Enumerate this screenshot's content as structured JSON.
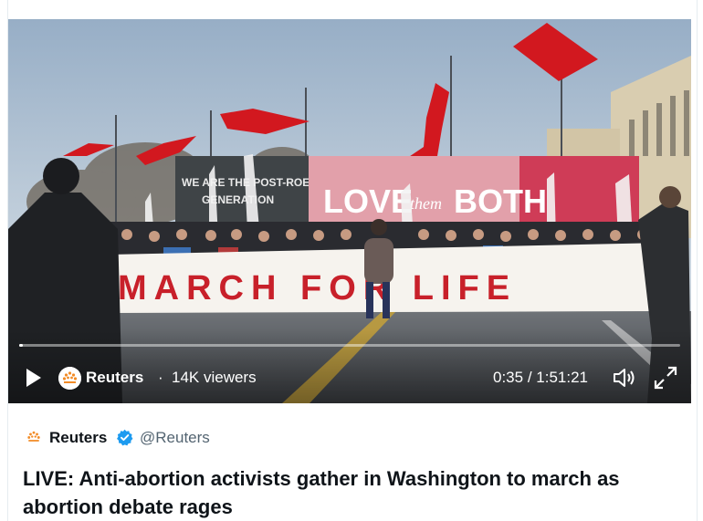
{
  "video": {
    "channel_name": "Reuters",
    "separator": "·",
    "viewers": "14K viewers",
    "current_time": "0:35",
    "time_separator": "/",
    "duration": "1:51:21",
    "progress_fraction": 0.005
  },
  "scene": {
    "banner_text": "MARCH FOR LIFE",
    "sign_left_text": "WE ARE THE POST-ROE GENERATION",
    "sign_right_text": "LOVE them BOTH"
  },
  "card": {
    "author_name": "Reuters",
    "author_handle": "@Reuters",
    "title": "LIVE: Anti-abortion activists gather in Washington to march as abortion debate rages"
  },
  "colors": {
    "verified": "#1d9bf0",
    "banner_text": "#c8202a",
    "flag": "#d2181f",
    "reuters_orange": "#f28c28"
  },
  "icons": {
    "play": "play-icon",
    "volume": "volume-icon",
    "fullscreen": "fullscreen-icon",
    "verified": "verified-badge-icon"
  }
}
